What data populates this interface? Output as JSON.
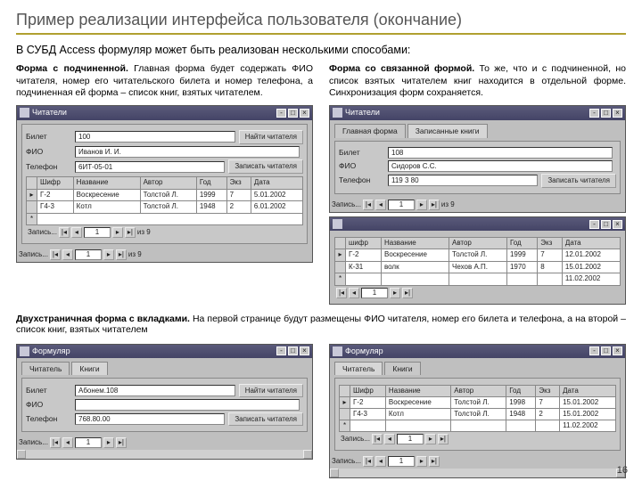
{
  "title": "Пример реализации  интерфейса пользователя (окончание)",
  "intro": "В СУБД Access формуляр может быть реализован несколькими способами:",
  "p1": {
    "head": "Форма с подчиненной.",
    "text": " Главная форма будет содержать ФИО читателя, номер его читательского билета и номер телефона, а подчиненная ей форма – список книг, взятых читателем."
  },
  "p2": {
    "head": "Форма со связанной формой.",
    "text": " То же, что и с подчиненной, но список взятых читателем книг находится в отдельной форме. Синхронизация форм сохраняется."
  },
  "p3": {
    "head": "Двухстраничная форма с вкладками.",
    "text": " На первой странице будут размещены ФИО читателя, номер его билета и телефона, а на второй – список книг, взятых читателем"
  },
  "win1": {
    "title": "Читатели",
    "lbl_bilet": "Билет",
    "bilet": "100",
    "lbl_fio": "ФИО",
    "fio": "Иванов И. И.",
    "lbl_tel": "Телефон",
    "tel": "6ИТ-05-01",
    "btn1": "Найти читателя",
    "btn2": "Записать читателя",
    "cols": [
      "Шифр",
      "Название",
      "Автор",
      "Год",
      "Экз",
      "Дата"
    ],
    "r1": [
      "Г-2",
      "Воскресение",
      "Толстой Л.",
      "1999",
      "7",
      "5.01.2002"
    ],
    "r2": [
      "Г4-3",
      "Котл",
      "Толстой Л.",
      "1948",
      "2",
      "6.01.2002"
    ],
    "nav": "Запись...",
    "navn": "1",
    "navt": "из 9"
  },
  "win2": {
    "title": "Читатели",
    "tab1": "Главная форма",
    "tab2": "Записанные книги",
    "lbl_bilet": "Билет",
    "bilet": "108",
    "lbl_fio": "ФИО",
    "fio": "Сидоров С.С.",
    "lbl_tel": "Телефон",
    "tel": "119 3 80",
    "btn1": "Записать читателя",
    "nav": "Запись...",
    "navn": "1",
    "navt": "из 9"
  },
  "win3": {
    "title": "",
    "cols": [
      "шифр",
      "Название",
      "Автор",
      "Год",
      "Экз",
      "Дата"
    ],
    "r1": [
      "Г-2",
      "Воскресение",
      "Толстой Л.",
      "1999",
      "7",
      "12.01.2002"
    ],
    "r2": [
      "К-31",
      "волк",
      "Чехов А.П.",
      "1970",
      "8",
      "15.01.2002"
    ],
    "r3": [
      "",
      "",
      "",
      "",
      "",
      "11.02.2002"
    ],
    "nav": "1"
  },
  "win4": {
    "title": "Формуляр",
    "tab1": "Читатель",
    "tab2": "Книги",
    "lbl_bilet": "Билет",
    "bilet": "Абонем.108",
    "lbl_fio": "ФИО",
    "fio": "",
    "lbl_tel": "Телефон",
    "tel": "768.80.00",
    "btn1": "Найти читателя",
    "btn2": "Записать читателя",
    "nav": "Запись...",
    "navn": "1"
  },
  "win5": {
    "title": "Формуляр",
    "tab1": "Читатель",
    "tab2": "Книги",
    "cols": [
      "Шифр",
      "Название",
      "Автор",
      "Год",
      "Экз",
      "Дата"
    ],
    "r1": [
      "Г-2",
      "Воскресение",
      "Толстой Л.",
      "1998",
      "7",
      "15.01.2002"
    ],
    "r2": [
      "Г4-3",
      "Котл",
      "Толстой Л.",
      "1948",
      "2",
      "15.01.2002"
    ],
    "r3": [
      "",
      "",
      "",
      "",
      "",
      "11.02.2002"
    ],
    "nav": "Запись...",
    "navn": "1"
  },
  "pagenum": "16"
}
